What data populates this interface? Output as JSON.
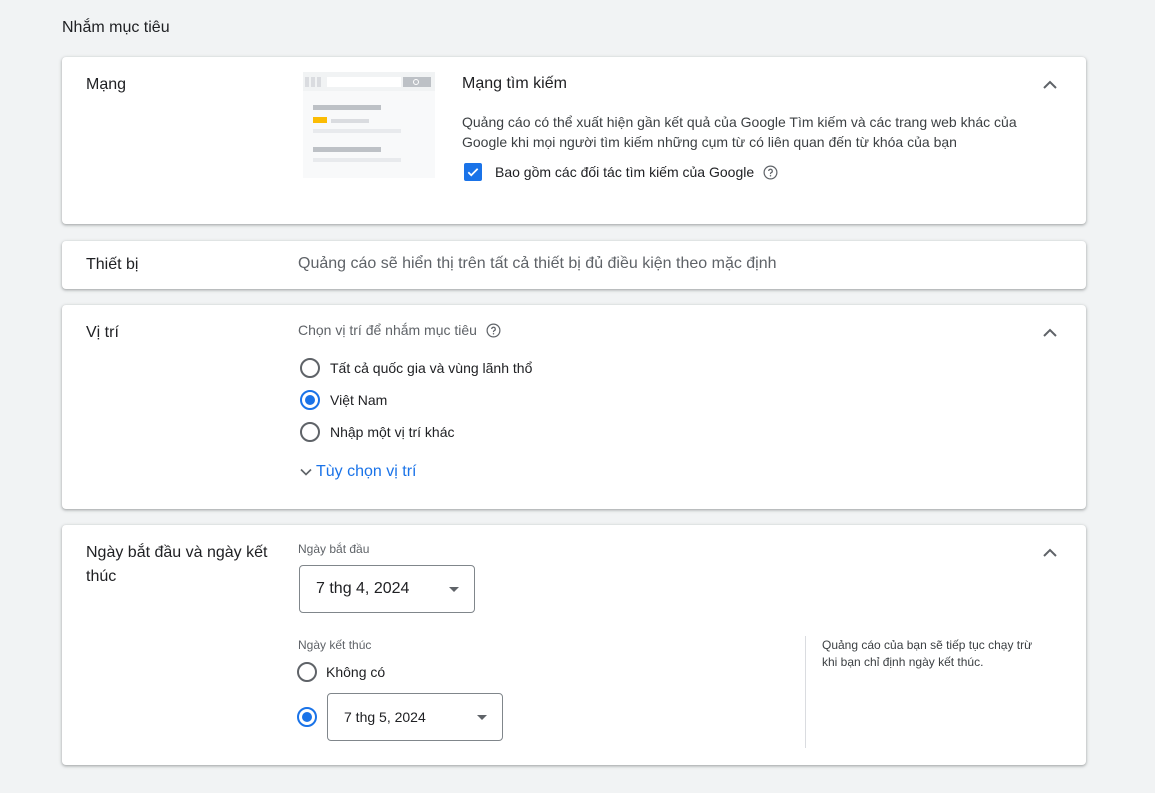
{
  "page": {
    "section_title": "Nhắm mục tiêu"
  },
  "network": {
    "label": "Mạng",
    "title": "Mạng tìm kiếm",
    "description": "Quảng cáo có thể xuất hiện gần kết quả của Google Tìm kiếm và các trang web khác của Google khi mọi người tìm kiếm những cụm từ có liên quan đến từ khóa của bạn",
    "partners_label": "Bao gồm các đối tác tìm kiếm của Google",
    "partners_checked": true
  },
  "devices": {
    "label": "Thiết bị",
    "description": "Quảng cáo sẽ hiển thị trên tất cả thiết bị đủ điều kiện theo mặc định"
  },
  "location": {
    "label": "Vị trí",
    "prompt": "Chọn vị trí để nhắm mục tiêu",
    "options": [
      {
        "label": "Tất cả quốc gia và vùng lãnh thổ",
        "checked": false
      },
      {
        "label": "Việt Nam",
        "checked": true
      },
      {
        "label": "Nhập một vị trí khác",
        "checked": false
      }
    ],
    "more_options": "Tùy chọn vị trí"
  },
  "dates": {
    "label": "Ngày bắt đầu và ngày kết thúc",
    "start_label": "Ngày bắt đầu",
    "start_value": "7 thg 4, 2024",
    "end_label": "Ngày kết thúc",
    "end_none": "Không có",
    "end_value": "7 thg 5, 2024",
    "end_selected": "date",
    "note": "Quảng cáo của bạn sẽ tiếp tục chạy trừ khi bạn chỉ định ngày kết thúc."
  },
  "colors": {
    "accent": "#1a73e8",
    "background": "#f1f3f4",
    "highlight": "#fbbc04"
  }
}
